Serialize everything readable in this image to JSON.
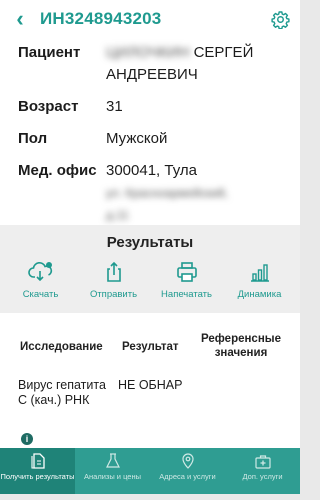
{
  "header": {
    "back_glyph": "‹",
    "title": "ИН3248943203"
  },
  "patient": {
    "fields": [
      {
        "label": "Пациент",
        "value_hidden": "ЦИЛОЧКИН",
        "value_visible": "СЕРГЕЙ",
        "value_line2": "АНДРЕЕВИЧ"
      },
      {
        "label": "Возраст",
        "value": "31"
      },
      {
        "label": "Пол",
        "value": "Мужской"
      },
      {
        "label": "Мед. офис",
        "value": "300041, Тула",
        "value_hidden_line2": "ул. Красноармейский,",
        "value_hidden_line3": "д.11"
      }
    ]
  },
  "results": {
    "title": "Результаты",
    "actions": [
      {
        "label": "Скачать",
        "icon": "cloud-download-icon"
      },
      {
        "label": "Отправить",
        "icon": "share-icon"
      },
      {
        "label": "Напечатать",
        "icon": "printer-icon"
      },
      {
        "label": "Динамика",
        "icon": "bar-chart-icon"
      }
    ]
  },
  "table": {
    "headers": [
      "Исследование",
      "Результат",
      "Референсные значения"
    ],
    "rows": [
      {
        "study": "Вирус гепатита С (кач.) РНК",
        "result": "НЕ ОБНАР",
        "reference": ""
      }
    ]
  },
  "bottom_nav": {
    "items": [
      {
        "label": "Получить результаты",
        "icon": "document-icon",
        "active": true
      },
      {
        "label": "Анализы и цены",
        "icon": "flask-icon",
        "active": false
      },
      {
        "label": "Адреса и услуги",
        "icon": "location-pin-icon",
        "active": false
      },
      {
        "label": "Доп. услуги",
        "icon": "medical-kit-icon",
        "active": false
      }
    ]
  },
  "colors": {
    "accent": "#1f9a8f",
    "nav_bg": "#2f9d92",
    "nav_active": "#1f8378"
  }
}
